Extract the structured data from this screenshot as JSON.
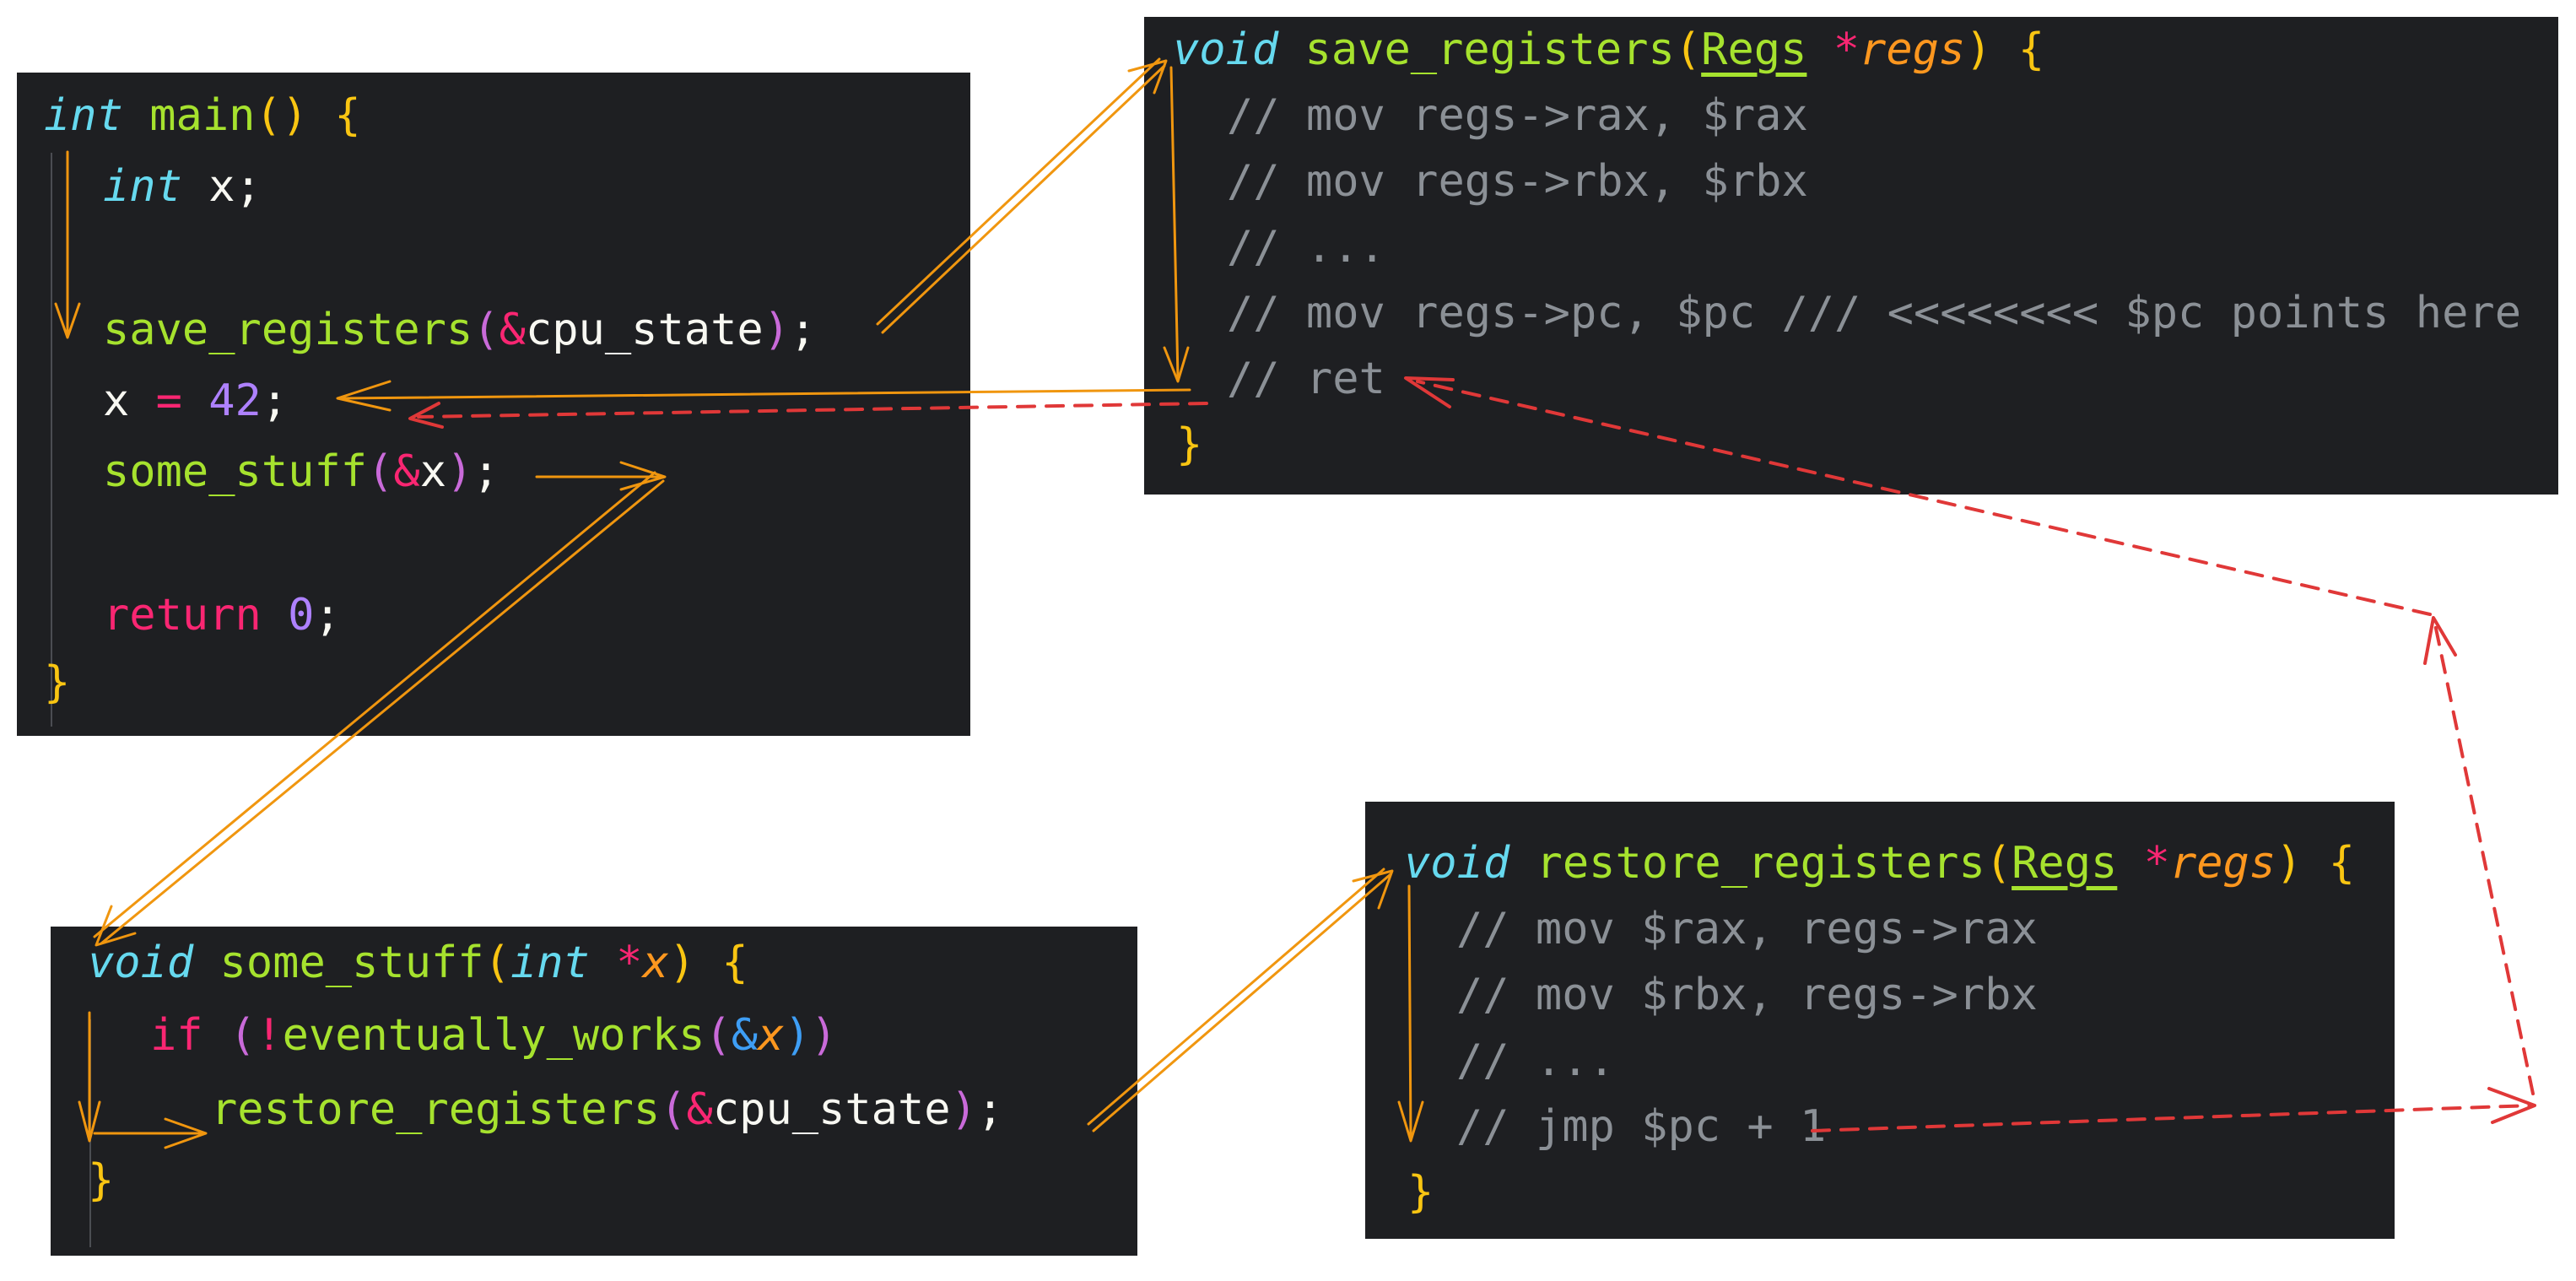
{
  "main_panel": {
    "lines": [
      {
        "type": "int",
        "name": "main",
        "open": "()",
        "brace": "{"
      },
      {
        "type": "int",
        "rest": "x;"
      },
      {
        "fn": "save_registers",
        "arg": "cpu_state",
        "end": ";"
      },
      {
        "lhs": "x",
        "op": "=",
        "num": "42",
        "end": ";"
      },
      {
        "fn": "some_stuff",
        "arg": "x",
        "end": ";"
      },
      {
        "kw": "return",
        "num": "0",
        "end": ";"
      },
      {
        "brace": "}"
      }
    ]
  },
  "save_panel": {
    "type": "void",
    "name": "save_registers",
    "param_type": "Regs",
    "param": "regs",
    "brace": "{",
    "comments": [
      "// mov regs->rax, $rax",
      "// mov regs->rbx, $rbx",
      "// ...",
      "// mov regs->pc, $pc /// <<<<<<<< $pc points here",
      "// ret"
    ],
    "close": "}"
  },
  "stuff_panel": {
    "type": "void",
    "name": "some_stuff",
    "param_type": "int",
    "param": "x",
    "brace": "{",
    "if_kw": "if",
    "cond_fn": "eventually_works",
    "cond_arg": "x",
    "call_fn": "restore_registers",
    "call_arg": "cpu_state",
    "end": ";",
    "close": "}"
  },
  "restore_panel": {
    "type": "void",
    "name": "restore_registers",
    "param_type": "Regs",
    "param": "regs",
    "brace": "{",
    "comments": [
      "// mov $rax, regs->rax",
      "// mov $rbx, regs->rbx",
      "// ...",
      "// jmp $pc + 1"
    ],
    "close": "}"
  },
  "colors": {
    "panel_bg": "#1e1f22",
    "call_arrow": "#f0960f",
    "return_arrow": "#e03838"
  }
}
